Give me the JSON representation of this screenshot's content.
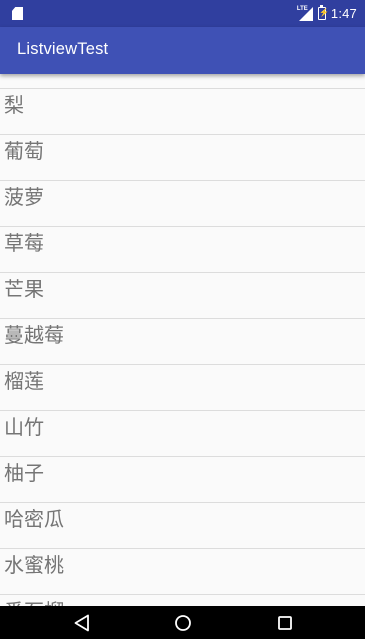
{
  "status_bar": {
    "time": "1:47",
    "network_label": "LTE",
    "icons": [
      "sd-card-icon",
      "signal-icon",
      "battery-charging-icon"
    ]
  },
  "app_bar": {
    "title": "ListviewTest"
  },
  "list": {
    "items": [
      "梨",
      "葡萄",
      "菠萝",
      "草莓",
      "芒果",
      "蔓越莓",
      "榴莲",
      "山竹",
      "柚子",
      "哈密瓜",
      "水蜜桃",
      "番石榴"
    ]
  },
  "nav_bar": {
    "buttons": [
      "back-icon",
      "home-icon",
      "recents-icon"
    ]
  },
  "colors": {
    "status_bar": "#303f9f",
    "app_bar": "#3f51b5",
    "list_background": "#fafafa",
    "item_text": "#757575",
    "divider": "#dcdcdc",
    "nav_bar": "#000000"
  }
}
